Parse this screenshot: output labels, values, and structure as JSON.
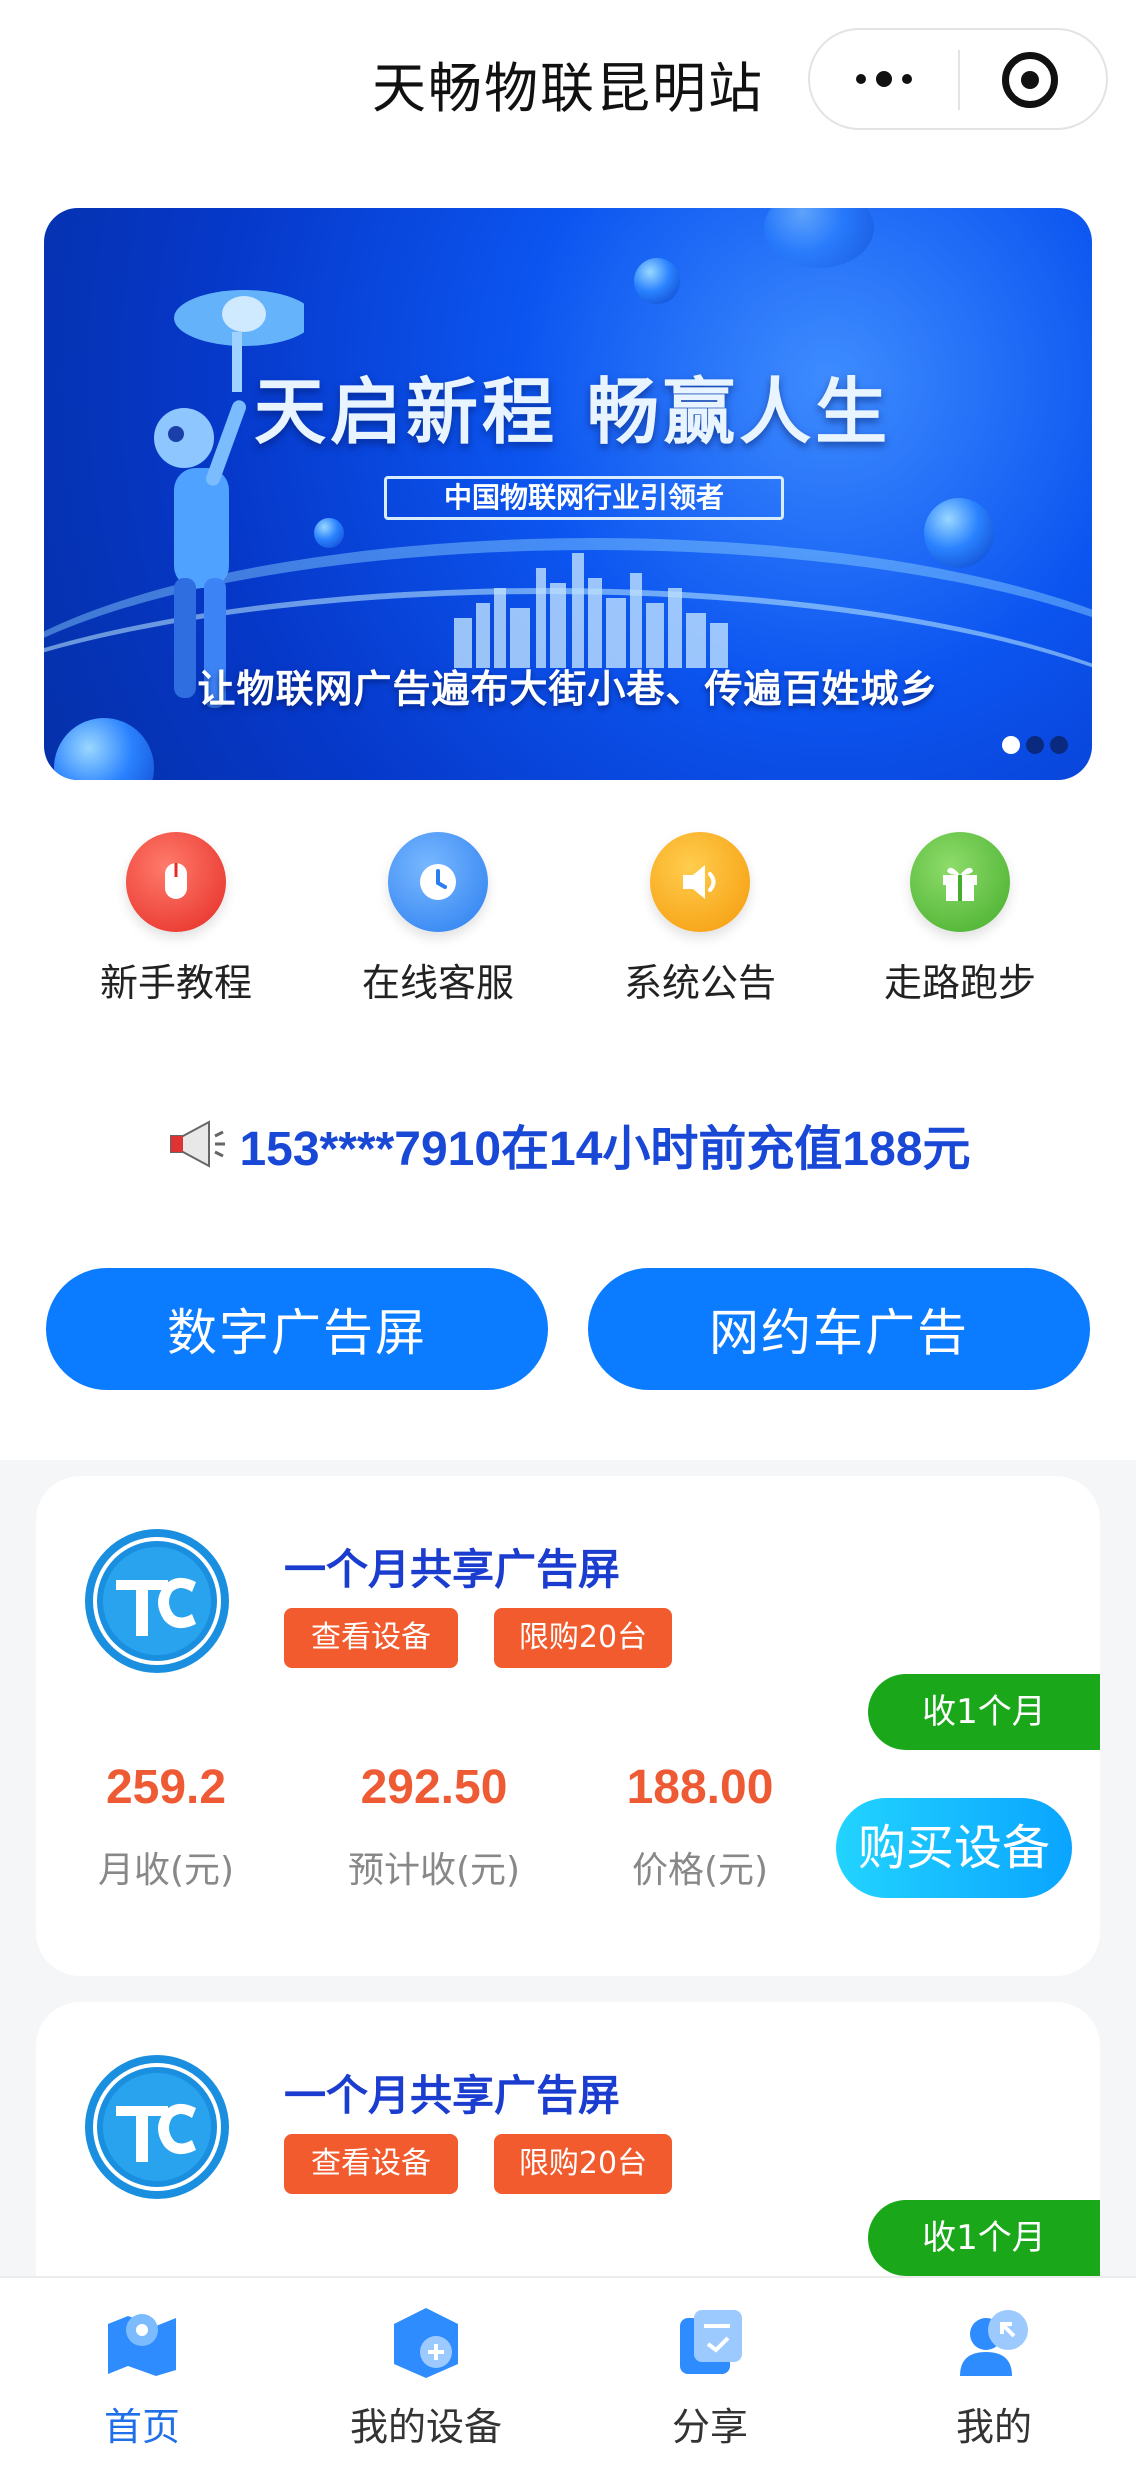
{
  "header": {
    "title": "天畅物联昆明站"
  },
  "banner": {
    "headline": "天启新程  畅赢人生",
    "tagline": "中国物联网行业引领者",
    "slogan": "让物联网广告遍布大街小巷、传遍百姓城乡"
  },
  "quick_links": [
    {
      "label": "新手教程",
      "icon": "mouse-icon",
      "color": "#e52b24"
    },
    {
      "label": "在线客服",
      "icon": "clock-icon",
      "color": "#2a7ef0"
    },
    {
      "label": "系统公告",
      "icon": "speaker-icon",
      "color": "#f59a0b"
    },
    {
      "label": "走路跑步",
      "icon": "gift-icon",
      "color": "#45ad2c"
    }
  ],
  "ticker": {
    "text": "153****7910在14小时前充值188元"
  },
  "categories": [
    {
      "label": "数字广告屏"
    },
    {
      "label": "网约车广告"
    }
  ],
  "products": [
    {
      "name": "一个月共享广告屏",
      "tags": [
        "查看设备",
        "限购20台"
      ],
      "ribbon": "收1个月",
      "stats": [
        {
          "value": "259.2",
          "label": "月收(元)"
        },
        {
          "value": "292.50",
          "label": "预计收(元)"
        },
        {
          "value": "188.00",
          "label": "价格(元)"
        }
      ],
      "buy_label": "购买设备"
    },
    {
      "name": "一个月共享广告屏",
      "tags": [
        "查看设备",
        "限购20台"
      ],
      "ribbon": "收1个月"
    }
  ],
  "tabbar": [
    {
      "label": "首页",
      "icon": "home-map-icon",
      "active": true
    },
    {
      "label": "我的设备",
      "icon": "device-add-icon",
      "active": false
    },
    {
      "label": "分享",
      "icon": "share-doc-icon",
      "active": false
    },
    {
      "label": "我的",
      "icon": "user-icon",
      "active": false
    }
  ],
  "colors": {
    "primary": "#0b7bff",
    "accent": "#f25b2e",
    "ribbon": "#1aa81a",
    "active_tab": "#1f6fe8"
  }
}
